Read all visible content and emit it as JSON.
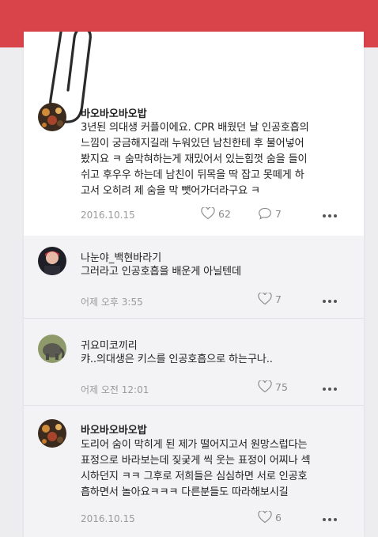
{
  "posts": [
    {
      "author": "바오바오바오밥",
      "text_lines": [
        "3년된 의대생 커플이에요. CPR 배웠던 날 인공호흡의",
        "느낌이 궁금해지길래 누워있던 남친한테 후 불어넣어",
        "봤지요 ㅋ 숨막혀하는게 재밌어서 있는힘껏 숨을 들이",
        "쉬고 후우우 하는데 남친이 뒤목을 딱 잡고 못떼게 하",
        "고서 오히려 제 숨을 막 뺏어가더라구요 ㅋ"
      ],
      "date": "2016.10.15",
      "likes": "62",
      "comments": "7"
    },
    {
      "author": "나눈야_백현바라기",
      "text_lines": [
        "그러라고 인공호흡을 배운게 아닐텐데"
      ],
      "date": "어제 오후 3:55",
      "likes": "7"
    },
    {
      "author": "귀요미코끼리",
      "text_lines": [
        "캬..의대생은 키스를 인공호흡으로 하는구나.."
      ],
      "date": "어제 오전 12:01",
      "likes": "75"
    },
    {
      "author": "바오바오바오밥",
      "text_lines": [
        "도리어 숨이 막히게 된 제가 떨어지고서 원망스럽다는",
        "표정으로 바라보는데 짖궂게 씩 웃는 표정이 어찌나 섹",
        "시하던지 ㅋㅋ 그후로 저희들은 심심하면 서로 인공호",
        "흡하면서 놀아요ㅋㅋㅋ 다른분들도 따라해보시길"
      ],
      "date": "2016.10.15",
      "likes": "6"
    }
  ],
  "icons": {
    "like": "heart-outline-icon",
    "comment": "speech-bubble-icon",
    "more": "more-dots-icon",
    "clip": "paperclip-icon"
  },
  "colors": {
    "topbar": "#d9434a",
    "card": "#ffffff",
    "reply_bg": "#f3f3f5",
    "meta_text": "#9a9a9a"
  }
}
